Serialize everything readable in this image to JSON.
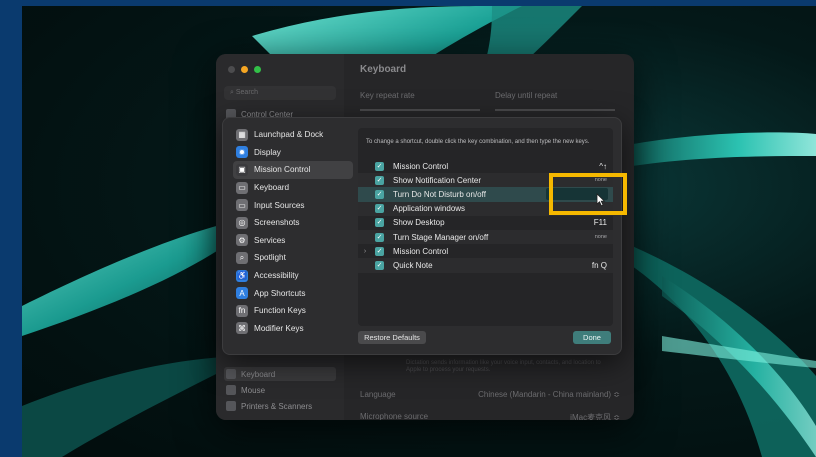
{
  "back_window": {
    "title": "Keyboard",
    "search_placeholder": "Search",
    "sidebar_top_item": "Control Center",
    "sidebar_bottom_items": [
      {
        "label": "Keyboard",
        "icon": "keyboard-icon"
      },
      {
        "label": "Mouse",
        "icon": "mouse-icon"
      },
      {
        "label": "Printers & Scanners",
        "icon": "printer-icon"
      }
    ],
    "key_repeat_label": "Key repeat rate",
    "delay_label": "Delay until repeat",
    "dictation_note": "Dictation sends information like your voice input, contacts, and location to Apple to process your requests.",
    "language_label": "Language",
    "language_value": "Chinese (Mandarin - China mainland) ≎",
    "mic_label": "Microphone source",
    "mic_value": "iMac麦克风 ≎"
  },
  "dialog": {
    "categories": [
      {
        "label": "Launchpad & Dock",
        "icon": "launchpad-icon",
        "color": "#6f6f73"
      },
      {
        "label": "Display",
        "icon": "display-icon",
        "color": "#2f7fe0"
      },
      {
        "label": "Mission Control",
        "icon": "mission-control-icon",
        "color": "#3a3a3d",
        "selected": true
      },
      {
        "label": "Keyboard",
        "icon": "keyboard-icon",
        "color": "#6f6f73"
      },
      {
        "label": "Input Sources",
        "icon": "input-sources-icon",
        "color": "#6f6f73"
      },
      {
        "label": "Screenshots",
        "icon": "screenshots-icon",
        "color": "#6f6f73"
      },
      {
        "label": "Services",
        "icon": "services-icon",
        "color": "#6f6f73"
      },
      {
        "label": "Spotlight",
        "icon": "spotlight-icon",
        "color": "#6f6f73"
      },
      {
        "label": "Accessibility",
        "icon": "accessibility-icon",
        "color": "#2f7fe0"
      },
      {
        "label": "App Shortcuts",
        "icon": "app-shortcuts-icon",
        "color": "#2f7fe0"
      },
      {
        "label": "Function Keys",
        "icon": "function-keys-icon",
        "color": "#6f6f73"
      },
      {
        "label": "Modifier Keys",
        "icon": "modifier-keys-icon",
        "color": "#6f6f73"
      }
    ],
    "info_text": "To change a shortcut, double click the key combination, and then type the new keys.",
    "shortcuts": [
      {
        "label": "Mission Control",
        "key": "^↑",
        "checked": true
      },
      {
        "label": "Show Notification Center",
        "key": "none",
        "checked": true
      },
      {
        "label": "Turn Do Not Disturb on/off",
        "key": "",
        "checked": true,
        "editing": true
      },
      {
        "label": "Application windows",
        "key": "",
        "checked": true
      },
      {
        "label": "Show Desktop",
        "key": "F11",
        "checked": true
      },
      {
        "label": "Turn Stage Manager on/off",
        "key": "none",
        "checked": true
      },
      {
        "label": "Mission Control",
        "key": "",
        "checked": true,
        "expandable": true
      },
      {
        "label": "Quick Note",
        "key": "fn Q",
        "checked": true
      }
    ],
    "restore_label": "Restore Defaults",
    "done_label": "Done"
  },
  "colors": {
    "accent": "#4aa4a2",
    "highlight_box": "#f5b800"
  }
}
